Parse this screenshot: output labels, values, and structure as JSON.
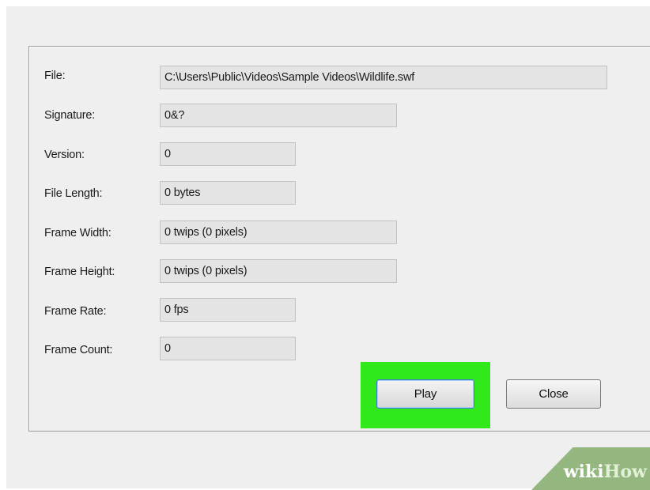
{
  "dialog": {
    "rows": [
      {
        "label": "File:",
        "value": "C:\\Users\\Public\\Videos\\Sample Videos\\Wildlife.swf"
      },
      {
        "label": "Signature:",
        "value": "0&?"
      },
      {
        "label": "Version:",
        "value": "0"
      },
      {
        "label": "File Length:",
        "value": "0 bytes"
      },
      {
        "label": "Frame Width:",
        "value": "0 twips (0 pixels)"
      },
      {
        "label": "Frame Height:",
        "value": "0 twips (0 pixels)"
      },
      {
        "label": "Frame Rate:",
        "value": "0 fps"
      },
      {
        "label": "Frame Count:",
        "value": "0"
      }
    ],
    "buttons": {
      "play_label": "Play",
      "close_label": "Close"
    }
  },
  "watermark": {
    "part1": "wiki",
    "part2": "How"
  },
  "colors": {
    "highlight": "#31e81b",
    "background": "#efefef",
    "watermark_band": "#93b77e"
  }
}
